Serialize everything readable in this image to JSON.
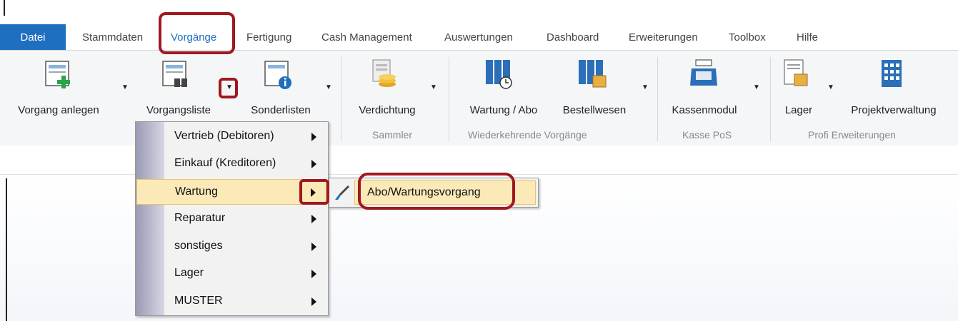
{
  "tabs": [
    "Datei",
    "Stammdaten",
    "Vorgänge",
    "Fertigung",
    "Cash Management",
    "Auswertungen",
    "Dashboard",
    "Erweiterungen",
    "Toolbox",
    "Hilfe"
  ],
  "ribbon": {
    "buttons": {
      "vorgang_anlegen": "Vorgang anlegen",
      "vorgangsliste": "Vorgangsliste",
      "sonderlisten": "Sonderlisten",
      "verdichtung": "Verdichtung",
      "wartung_abo": "Wartung / Abo",
      "bestellwesen": "Bestellwesen",
      "kassenmodul": "Kassenmodul",
      "lager": "Lager",
      "projektverwaltung": "Projektverwaltung"
    },
    "groups": {
      "sammler": "Sammler",
      "wiederkehrende": "Wiederkehrende Vorgänge",
      "kasse": "Kasse PoS",
      "profi": "Profi Erweiterungen"
    }
  },
  "menu": {
    "items": [
      "Vertrieb (Debitoren)",
      "Einkauf (Kreditoren)",
      "Wartung",
      "Reparatur",
      "sonstiges",
      "Lager",
      "MUSTER"
    ],
    "highlighted": "Wartung"
  },
  "submenu": {
    "item": "Abo/Wartungsvorgang"
  },
  "colors": {
    "accent": "#1f6fc0",
    "highlight": "#fbe9b8",
    "annotation": "#a01820"
  }
}
